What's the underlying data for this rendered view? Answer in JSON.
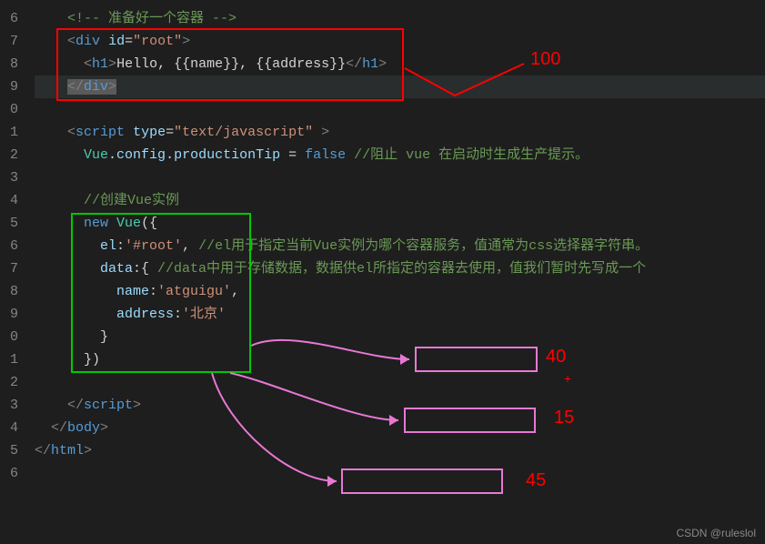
{
  "gutter_lines": [
    "6",
    "7",
    "8",
    "9",
    "0",
    "1",
    "2",
    "3",
    "4",
    "5",
    "6",
    "7",
    "8",
    "9",
    "0",
    "1",
    "2",
    "3",
    "4",
    "5",
    "6"
  ],
  "code": {
    "l1_comment": "<!-- 准备好一个容器 -->",
    "l2_div_open": "<div id=\"root\">",
    "l3_h1": "<h1>Hello, {{name}}, {{address}}</h1>",
    "l4_div_close": "</div>",
    "l6_script_open": "<script type=\"text/javascript\" >",
    "l7_vueconfig": "Vue.config.productionTip = false",
    "l7_comment": " //阻止 vue 在启动时生成生产提示。",
    "l9_comment": "//创建Vue实例",
    "l10_newvue": "new Vue({",
    "l11_el": "el:'#root',",
    "l11_comment": " //el用于指定当前Vue实例为哪个容器服务，值通常为css选择器字符串。",
    "l12_data": "data:{",
    "l12_comment": " //data中用于存储数据，数据供el所指定的容器去使用，值我们暂时先写成一个",
    "l13_name": "name:'atguigu',",
    "l14_address": "address:'北京'",
    "l15_close": "}",
    "l16_close": "})",
    "l18_script_close": "</script>",
    "l19_body_close": "</body>",
    "l20_html_close": "</html>"
  },
  "annotations": {
    "a1": "100",
    "a2": "40",
    "a3": "15",
    "a4": "45",
    "plus": "+"
  },
  "watermark": "CSDN @ruleslol"
}
